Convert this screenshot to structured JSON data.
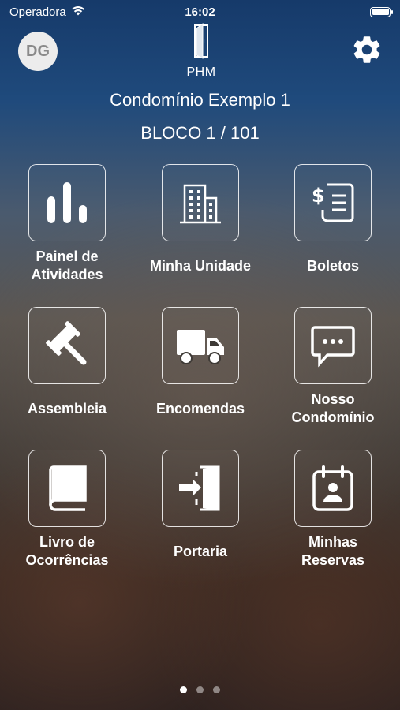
{
  "status_bar": {
    "carrier": "Operadora",
    "time": "16:02"
  },
  "header": {
    "avatar_initials": "DG",
    "logo_text": "PHM"
  },
  "condo": {
    "name": "Condomínio Exemplo 1",
    "unit": "BLOCO 1 / 101"
  },
  "menu": [
    {
      "label": "Painel de\nAtividades",
      "icon": "bar-chart-icon"
    },
    {
      "label": "Minha Unidade",
      "icon": "building-icon"
    },
    {
      "label": "Boletos",
      "icon": "invoice-icon"
    },
    {
      "label": "Assembleia",
      "icon": "gavel-icon"
    },
    {
      "label": "Encomendas",
      "icon": "truck-icon"
    },
    {
      "label": "Nosso\nCondomínio",
      "icon": "chat-icon"
    },
    {
      "label": "Livro de\nOcorrências",
      "icon": "book-icon"
    },
    {
      "label": "Portaria",
      "icon": "door-enter-icon"
    },
    {
      "label": "Minhas\nReservas",
      "icon": "calendar-person-icon"
    }
  ],
  "pagination": {
    "total": 3,
    "active": 1
  },
  "colors": {
    "text": "#ffffff",
    "avatar_bg": "#ececec",
    "avatar_text": "#8a8a8a"
  }
}
